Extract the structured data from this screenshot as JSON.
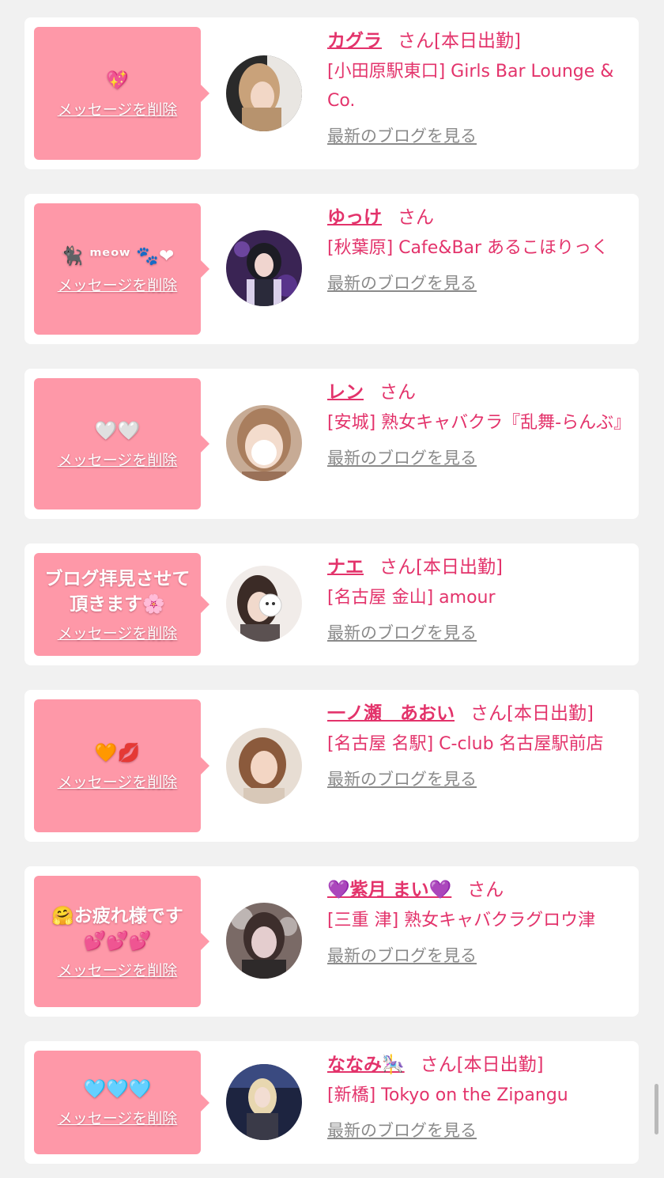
{
  "cards": [
    {
      "message": "💖",
      "delete_label": "メッセージを削除",
      "name": "カグラ",
      "suffix": "さん",
      "status": "[本日出勤]",
      "shop": "[小田原駅東口] Girls Bar Lounge & Co.",
      "blog_link": "最新のブログを見る"
    },
    {
      "message": "🐈‍⬛ ᵐᵉᵒʷ 🐾❤",
      "delete_label": "メッセージを削除",
      "name": "ゆっけ",
      "suffix": "さん",
      "status": "",
      "shop": "[秋葉原] Cafe&Bar あるこほりっく",
      "blog_link": "最新のブログを見る"
    },
    {
      "message": "🤍🤍",
      "delete_label": "メッセージを削除",
      "name": "レン",
      "suffix": "さん",
      "status": "",
      "shop": "[安城] 熟女キャバクラ『乱舞-らんぶ』",
      "blog_link": "最新のブログを見る"
    },
    {
      "message": "ブログ拝見させて頂きます🌸",
      "delete_label": "メッセージを削除",
      "name": "ナエ",
      "suffix": "さん",
      "status": "[本日出勤]",
      "shop": "[名古屋 金山] amour",
      "blog_link": "最新のブログを見る"
    },
    {
      "message": "🧡💋",
      "delete_label": "メッセージを削除",
      "name": "一ノ瀬　あおい",
      "suffix": "さん",
      "status": "[本日出勤]",
      "shop": "[名古屋 名駅] C-club 名古屋駅前店",
      "blog_link": "最新のブログを見る"
    },
    {
      "message": "🤗お疲れ様です💕💕💕",
      "delete_label": "メッセージを削除",
      "name": "💜紫月 まい💜",
      "suffix": "さん",
      "status": "",
      "shop": "[三重 津] 熟女キャバクラグロウ津",
      "blog_link": "最新のブログを見る"
    },
    {
      "message": "🩵🩵🩵",
      "delete_label": "メッセージを削除",
      "name": "ななみ🎠",
      "suffix": "さん",
      "status": "[本日出勤]",
      "shop": "[新橋] Tokyo on the Zipangu",
      "blog_link": "最新のブログを見る"
    }
  ]
}
